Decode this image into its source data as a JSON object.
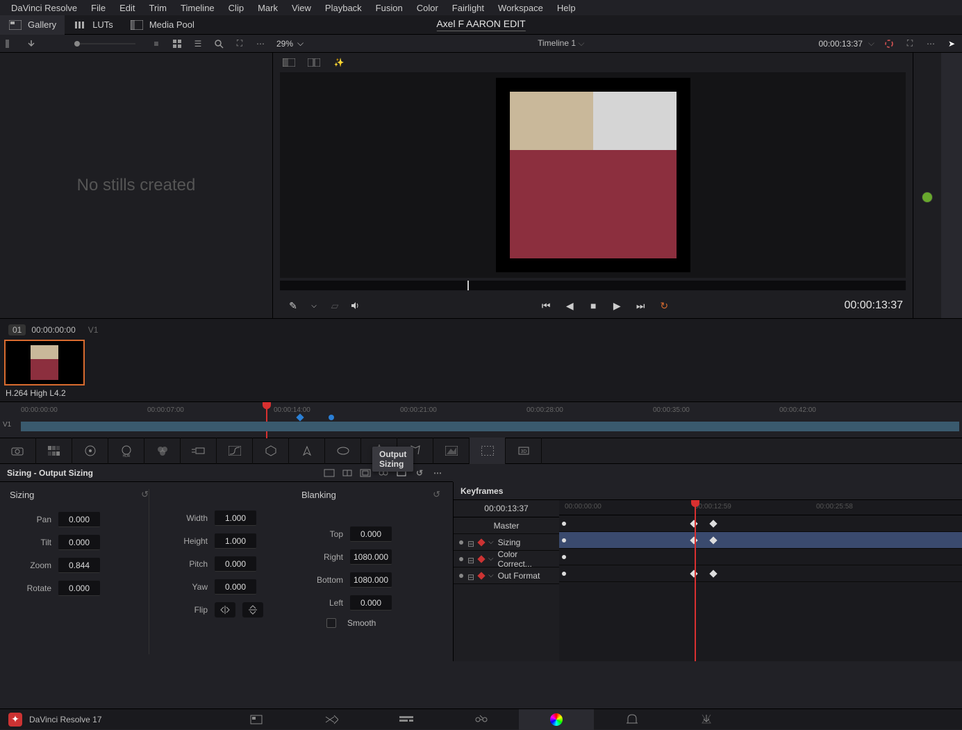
{
  "menu": [
    "DaVinci Resolve",
    "File",
    "Edit",
    "Trim",
    "Timeline",
    "Clip",
    "Mark",
    "View",
    "Playback",
    "Fusion",
    "Color",
    "Fairlight",
    "Workspace",
    "Help"
  ],
  "topbar": {
    "gallery": "Gallery",
    "luts": "LUTs",
    "mediapool": "Media Pool"
  },
  "project": "Axel F AARON EDIT",
  "viewer": {
    "zoom": "29%",
    "timeline_label": "Timeline 1",
    "timecode": "00:00:13:37",
    "play_tc": "00:00:13:37"
  },
  "gallery_empty": "No stills created",
  "clip": {
    "num": "01",
    "start_tc": "00:00:00:00",
    "track": "V1",
    "codec": "H.264 High L4.2"
  },
  "mini_marks": [
    "00:00:00:00",
    "00:00:07:00",
    "00:00:14:00",
    "00:00:21:00",
    "00:00:28:00",
    "00:00:35:00",
    "00:00:42:00"
  ],
  "panel_title": "Sizing - Output Sizing",
  "tooltip": "Output Sizing",
  "sizing": {
    "header": "Sizing",
    "pan": {
      "label": "Pan",
      "value": "0.000"
    },
    "tilt": {
      "label": "Tilt",
      "value": "0.000"
    },
    "zoom": {
      "label": "Zoom",
      "value": "0.844"
    },
    "rotate": {
      "label": "Rotate",
      "value": "0.000"
    },
    "width": {
      "label": "Width",
      "value": "1.000"
    },
    "height": {
      "label": "Height",
      "value": "1.000"
    },
    "pitch": {
      "label": "Pitch",
      "value": "0.000"
    },
    "yaw": {
      "label": "Yaw",
      "value": "0.000"
    },
    "flip": "Flip"
  },
  "blanking": {
    "header": "Blanking",
    "top": {
      "label": "Top",
      "value": "0.000"
    },
    "right": {
      "label": "Right",
      "value": "1080.000"
    },
    "bottom": {
      "label": "Bottom",
      "value": "1080.000"
    },
    "left": {
      "label": "Left",
      "value": "0.000"
    },
    "smooth": "Smooth"
  },
  "keyframes": {
    "title": "Keyframes",
    "tc": "00:00:13:37",
    "marks": [
      "00:00:00:00",
      "00:00:12:59",
      "00:00:25:58"
    ],
    "tracks": [
      "Master",
      "Sizing",
      "Color Correct...",
      "Out Format"
    ]
  },
  "app_version": "DaVinci Resolve 17"
}
